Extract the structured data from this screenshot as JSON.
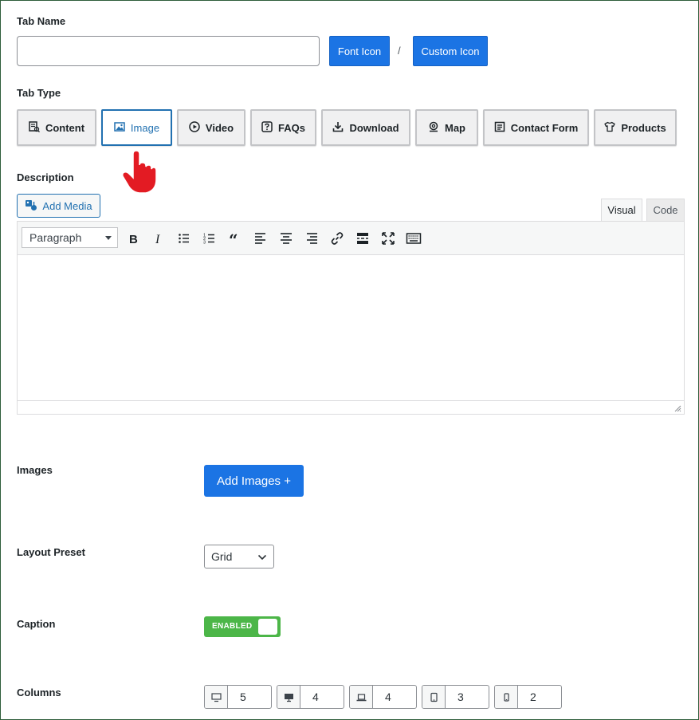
{
  "tab_name": {
    "label": "Tab Name",
    "value": "",
    "font_icon": "Font Icon",
    "separator": "/",
    "custom_icon": "Custom Icon"
  },
  "tab_type": {
    "label": "Tab Type",
    "options": [
      {
        "label": "Content",
        "icon": "content-icon"
      },
      {
        "label": "Image",
        "icon": "image-icon",
        "active": true
      },
      {
        "label": "Video",
        "icon": "video-icon"
      },
      {
        "label": "FAQs",
        "icon": "faq-icon"
      },
      {
        "label": "Download",
        "icon": "download-icon"
      },
      {
        "label": "Map",
        "icon": "map-icon"
      },
      {
        "label": "Contact Form",
        "icon": "contact-form-icon"
      },
      {
        "label": "Products",
        "icon": "products-icon"
      }
    ]
  },
  "description": {
    "label": "Description",
    "add_media": "Add Media",
    "tabs": {
      "visual": "Visual",
      "code": "Code"
    },
    "format_select": "Paragraph",
    "toolbar": [
      "bold",
      "italic",
      "bullet-list",
      "numbered-list",
      "blockquote",
      "align-left",
      "align-center",
      "align-right",
      "link",
      "read-more",
      "fullscreen",
      "toolbar-toggle"
    ]
  },
  "images": {
    "label": "Images",
    "button": "Add Images +"
  },
  "layout_preset": {
    "label": "Layout Preset",
    "value": "Grid"
  },
  "caption": {
    "label": "Caption",
    "toggle": "ENABLED",
    "enabled": true
  },
  "columns": {
    "label": "Columns",
    "fields": [
      {
        "device": "large-desktop-icon",
        "value": "5"
      },
      {
        "device": "desktop-icon",
        "value": "4"
      },
      {
        "device": "laptop-icon",
        "value": "4"
      },
      {
        "device": "tablet-icon",
        "value": "3"
      },
      {
        "device": "mobile-icon",
        "value": "2"
      }
    ]
  },
  "colors": {
    "primary": "#1b74e4",
    "active": "#2271b1",
    "toggle": "#4cb648",
    "cursor": "#e31b23"
  }
}
